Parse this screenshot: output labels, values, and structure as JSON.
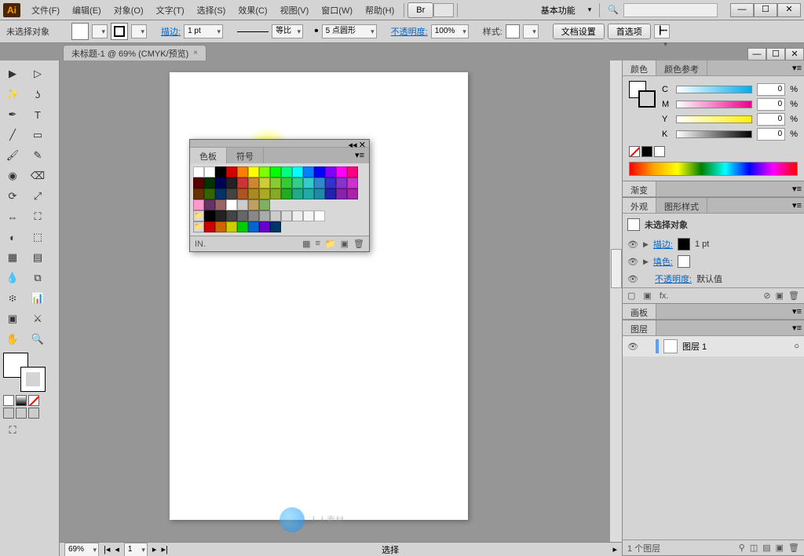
{
  "app": {
    "logo": "Ai"
  },
  "menu": {
    "items": [
      "文件(F)",
      "编辑(E)",
      "对象(O)",
      "文字(T)",
      "选择(S)",
      "效果(C)",
      "视图(V)",
      "窗口(W)",
      "帮助(H)"
    ],
    "br_btn": "Br",
    "workspace": "基本功能",
    "search_placeholder": ""
  },
  "window_buttons": {
    "min": "—",
    "max": "☐",
    "close": "✕"
  },
  "controlbar": {
    "selection": "未选择对象",
    "stroke_label": "描边:",
    "stroke_weight": "1 pt",
    "scale_label": "等比",
    "brush_label": "5 点圆形",
    "opacity_label": "不透明度:",
    "opacity_value": "100%",
    "style_label": "样式:",
    "doc_settings": "文档设置",
    "prefs": "首选项"
  },
  "doc_tab": {
    "title": "未标题-1 @ 69% (CMYK/预览)",
    "close": "×"
  },
  "swatches_panel": {
    "tabs": [
      "色板",
      "符号"
    ],
    "colors": [
      [
        "#ffffff",
        "#fefefe",
        "#000000",
        "#d30000",
        "#ff7f00",
        "#ffff00",
        "#7fff00",
        "#00ff00",
        "#00ff7f",
        "#00ffff",
        "#007fff",
        "#0000ff",
        "#7f00ff",
        "#ff00ff",
        "#ff007f"
      ],
      [
        "#5b0000",
        "#003300",
        "#000055",
        "#222222",
        "#cc3333",
        "#cc8833",
        "#cccc33",
        "#88cc33",
        "#33cc33",
        "#33cc88",
        "#33cccc",
        "#3388cc",
        "#3333cc",
        "#8833cc",
        "#cc33cc"
      ],
      [
        "#663300",
        "#336600",
        "#003366",
        "#444444",
        "#aa5522",
        "#aa8822",
        "#aaaa22",
        "#88aa22",
        "#22aa22",
        "#22aa88",
        "#22aaaa",
        "#2288aa",
        "#2222aa",
        "#8822aa",
        "#aa22aa"
      ],
      [
        "#ff99cc",
        "#663366",
        "#996666",
        "#ffffff",
        "#cccccc",
        "#c0a060",
        "#80b060"
      ],
      [
        "#000000",
        "#222222",
        "#444444",
        "#666666",
        "#888888",
        "#aaaaaa",
        "#cccccc",
        "#dddddd",
        "#eeeeee",
        "#f5f5f5",
        "#ffffff"
      ],
      [
        "#cc0000",
        "#cc6600",
        "#cccc00",
        "#00cc00",
        "#0066cc",
        "#6600cc",
        "#003366"
      ]
    ],
    "footer": "IN."
  },
  "status": {
    "zoom": "69%",
    "page": "1",
    "tool": "选择"
  },
  "panel_color": {
    "tabs": [
      "颜色",
      "颜色参考"
    ],
    "rows": [
      {
        "label": "C",
        "bg": "linear-gradient(to right,#fff,#00aeef)",
        "val": "0",
        "pct": "%"
      },
      {
        "label": "M",
        "bg": "linear-gradient(to right,#fff,#ec008c)",
        "val": "0",
        "pct": "%"
      },
      {
        "label": "Y",
        "bg": "linear-gradient(to right,#fff,#fff200)",
        "val": "0",
        "pct": "%"
      },
      {
        "label": "K",
        "bg": "linear-gradient(to right,#fff,#000000)",
        "val": "0",
        "pct": "%"
      }
    ]
  },
  "panel_gradient": {
    "tab": "渐变"
  },
  "panel_appearance": {
    "tabs": [
      "外观",
      "图形样式"
    ],
    "title": "未选择对象",
    "rows": [
      {
        "label": "描边:",
        "val": "1 pt",
        "swatch": "#000000"
      },
      {
        "label": "填色:",
        "val": "",
        "swatch": "#ffffff"
      }
    ],
    "opacity_row": {
      "label": "不透明度:",
      "val": "默认值"
    },
    "footer_fx": "fx."
  },
  "panel_artboards": {
    "tab": "画板"
  },
  "panel_layers": {
    "tab": "图层",
    "layer_name": "图层 1",
    "footer": "1 个图层"
  },
  "watermark": "人人素材"
}
